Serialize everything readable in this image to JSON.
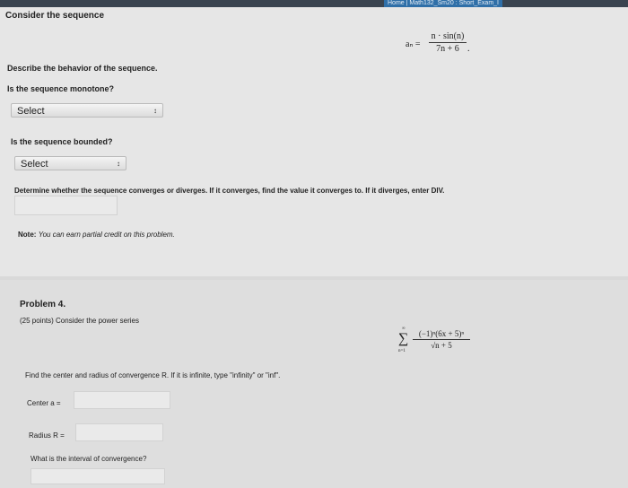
{
  "header": {
    "breadcrumb": "Home | Math132_Sm20 : Short_Exam_I"
  },
  "problem3": {
    "title": "Consider the sequence",
    "formula_lhs": "aₙ =",
    "formula_num": "n · sin(n)",
    "formula_den": "7n + 6",
    "formula_dot": ".",
    "describe": "Describe the behavior of the sequence.",
    "q_monotone": "Is the sequence monotone?",
    "select_monotone": "Select",
    "q_bounded": "Is the sequence bounded?",
    "select_bounded": "Select",
    "q_converge": "Determine whether the sequence converges or diverges. If it converges, find the value it converges to. If it diverges, enter DIV.",
    "note_label": "Note:",
    "note_text": "You can earn partial credit on this problem."
  },
  "problem4": {
    "title": "Problem 4.",
    "intro": "(25 points) Consider the power series",
    "sum_top": "∞",
    "sum_bottom": "n=1",
    "series_num": "(−1)ⁿ(6x + 5)ⁿ",
    "series_den": "√n + 5",
    "find": "Find the center and radius of convergence R. If it is infinite, type \"infinity\" or \"inf\".",
    "center_label": "Center a =",
    "radius_label": "Radius R =",
    "interval_label": "What is the interval of convergence?"
  },
  "icons": {
    "select_arrow": "↕"
  }
}
